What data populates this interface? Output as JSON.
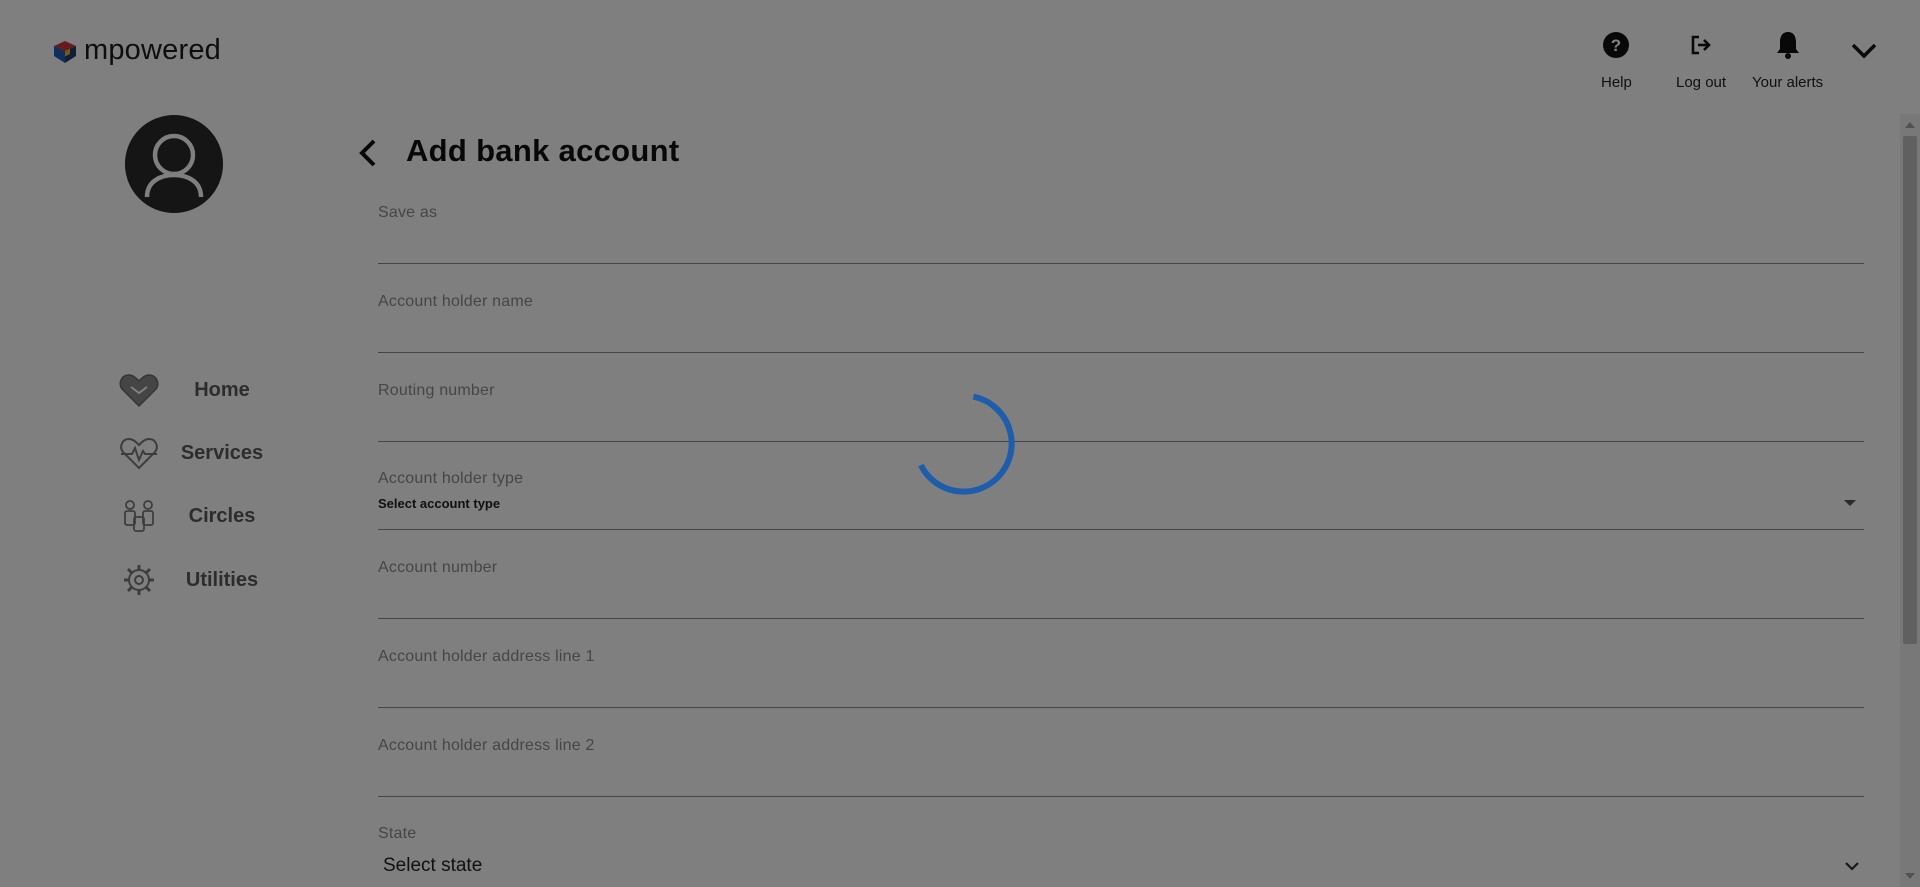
{
  "app": {
    "brand": "mpowered",
    "brand_colors": {
      "red": "#d2343b",
      "blue": "#1f5fb8",
      "yellow": "#e9b22a",
      "navy": "#233d6e"
    }
  },
  "header": {
    "help_label": "Help",
    "logout_label": "Log out",
    "alerts_label": "Your alerts",
    "icons": {
      "help": "help-circle-icon",
      "logout": "logout-icon",
      "alerts": "bell-icon",
      "menu": "chevron-down-icon"
    }
  },
  "sidebar": {
    "avatar_icon": "user-avatar-icon",
    "items": [
      {
        "label": "Home",
        "icon": "home-heart-icon"
      },
      {
        "label": "Services",
        "icon": "heart-pulse-icon"
      },
      {
        "label": "Circles",
        "icon": "people-icon"
      },
      {
        "label": "Utilities",
        "icon": "gear-icon"
      }
    ]
  },
  "main": {
    "title": "Add bank account",
    "back_icon": "chevron-left-icon",
    "fields": {
      "save_as": {
        "label": "Save as",
        "value": ""
      },
      "account_holder_name": {
        "label": "Account holder name",
        "value": ""
      },
      "routing_number": {
        "label": "Routing number",
        "value": ""
      },
      "account_holder_type": {
        "label": "Account holder type",
        "selected": "Select account type"
      },
      "account_number": {
        "label": "Account number",
        "value": ""
      },
      "address_line_1": {
        "label": "Account holder address line 1",
        "value": ""
      },
      "address_line_2": {
        "label": "Account holder address line 2",
        "value": ""
      },
      "state": {
        "label": "State",
        "selected": "Select state"
      }
    }
  },
  "loading": {
    "spinner_color": "#1e5dab",
    "overlay": "rgba(0,0,0,0.5)"
  }
}
